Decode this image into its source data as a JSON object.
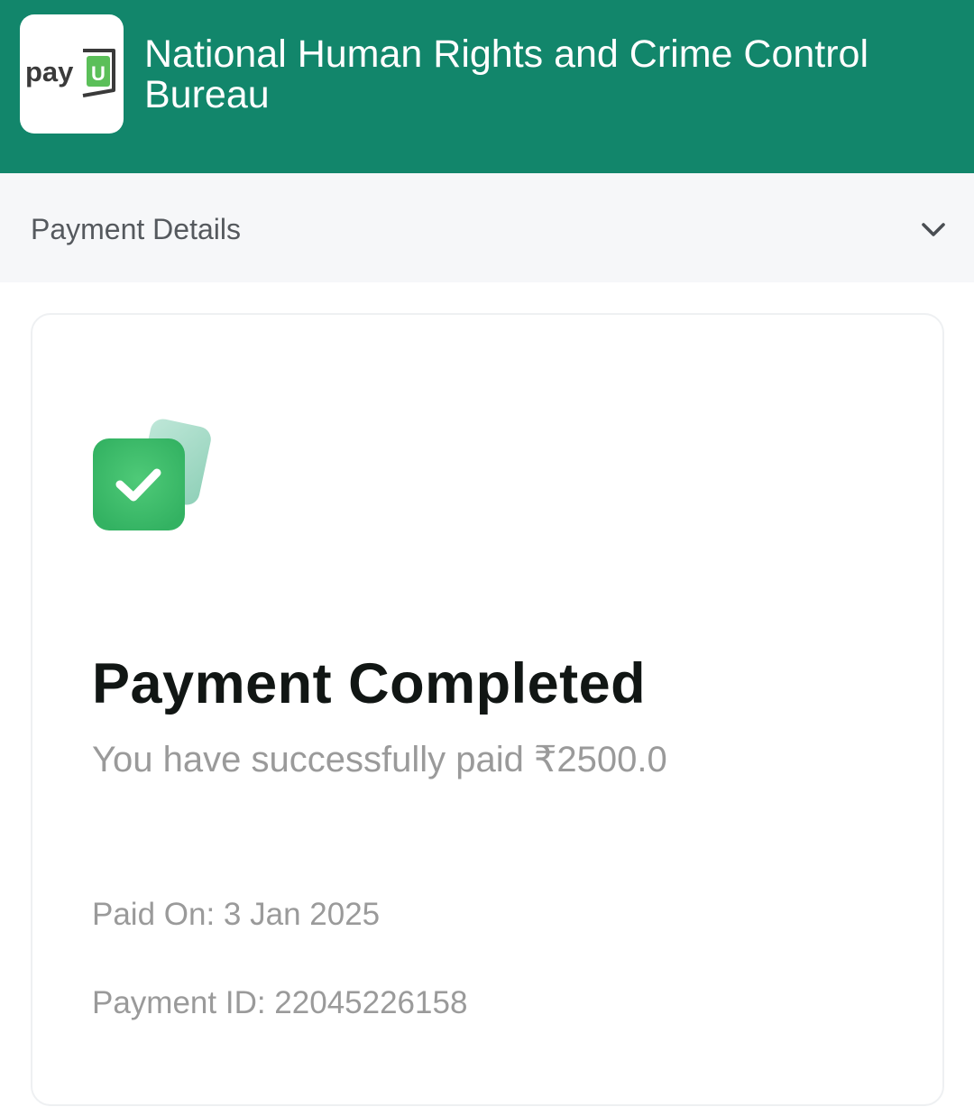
{
  "header": {
    "logo_text": "payU",
    "merchant_name": "National Human Rights and Crime Control Bureau"
  },
  "details": {
    "label": "Payment Details",
    "toggle_icon": "chevron-down-icon"
  },
  "status": {
    "icon": "check-icon",
    "title": "Payment Completed",
    "message": "You have successfully paid ₹2500.0",
    "paid_on": "Paid On: 3 Jan 2025",
    "payment_id": "Payment ID: 22045226158"
  },
  "colors": {
    "brand": "#12866b",
    "success": "#3dbb6b",
    "logo_green": "#5bbf59"
  }
}
